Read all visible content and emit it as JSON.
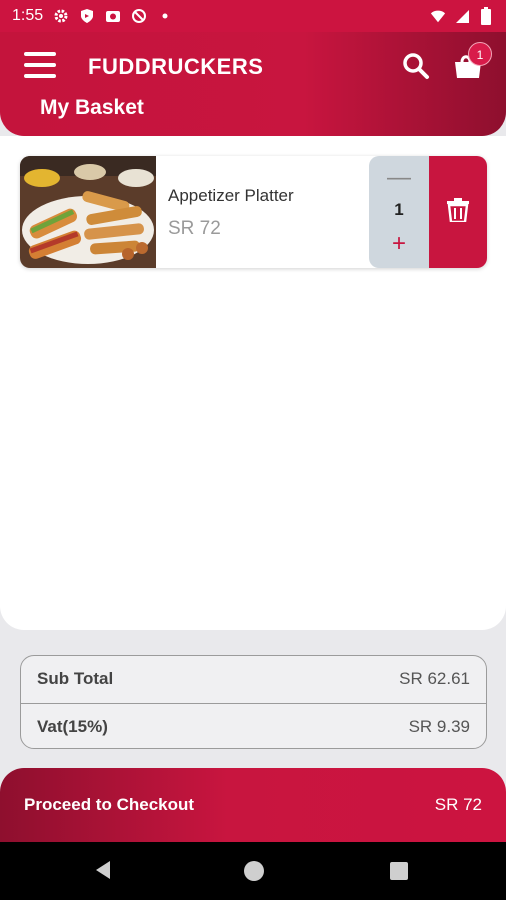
{
  "status_bar": {
    "time": "1:55",
    "left_icons": [
      "settings-icon",
      "shield-icon",
      "camera-icon",
      "do-not-disturb-icon",
      "dot-icon"
    ],
    "right_icons": [
      "wifi-icon",
      "signal-icon",
      "battery-icon"
    ]
  },
  "header": {
    "brand": "FUDDRUCKERS",
    "page_title": "My Basket",
    "cart_count": "1"
  },
  "basket": {
    "items": [
      {
        "name": "Appetizer Platter",
        "price": "SR 72",
        "quantity": "1",
        "minus_symbol": "—",
        "plus_symbol": "+"
      }
    ]
  },
  "summary": {
    "subtotal_label": "Sub Total",
    "subtotal_value": "SR 62.61",
    "vat_label": "Vat(15%)",
    "vat_value": "SR 9.39"
  },
  "checkout": {
    "label": "Proceed to Checkout",
    "total": "SR 72"
  },
  "colors": {
    "brand_red": "#c8153f",
    "dark_red": "#8e0f2e",
    "qty_bg": "#cfd7de"
  }
}
